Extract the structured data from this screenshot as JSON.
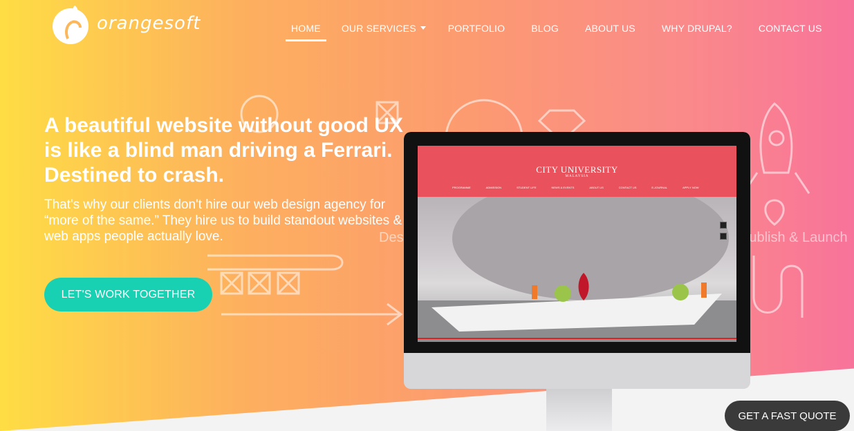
{
  "brand": {
    "logo_text": "orangesoft",
    "logo_icon": "orange-fruit-icon"
  },
  "nav": {
    "items": [
      {
        "label": "HOME",
        "active": true
      },
      {
        "label": "OUR SERVICES",
        "has_dropdown": true
      },
      {
        "label": "PORTFOLIO"
      },
      {
        "label": "BLOG"
      },
      {
        "label": "ABOUT US"
      },
      {
        "label": "WHY DRUPAL?"
      },
      {
        "label": "CONTACT US"
      }
    ]
  },
  "hero": {
    "headline": "A beautiful website without good UX is like a blind man driving a Ferrari. Destined to crash.",
    "subtext": "That's why our clients don't hire our web design agency for “more of the same.” They hire us to build standout websites & web apps people actually love.",
    "cta_label": "LET'S WORK TOGETHER",
    "background_words": [
      "Design",
      "Publish & Launch"
    ]
  },
  "monitor_preview": {
    "site_title": "CITY UNIVERSITY",
    "site_subtitle": "MALAYSIA",
    "site_nav": [
      "PROGRAMME",
      "ADMISSION",
      "STUDENT LIFE",
      "NEWS & EVENTS",
      "ABOUT US",
      "CONTACT US",
      "E-JOURNAL",
      "APPLY NOW"
    ]
  },
  "floating": {
    "quote_label": "GET A FAST QUOTE"
  },
  "colors": {
    "gradient_left": "#fedd44",
    "gradient_right": "#f8739a",
    "cta": "#17d1b2",
    "quote_button": "#3a3a3a",
    "site_header": "#e9525c"
  }
}
